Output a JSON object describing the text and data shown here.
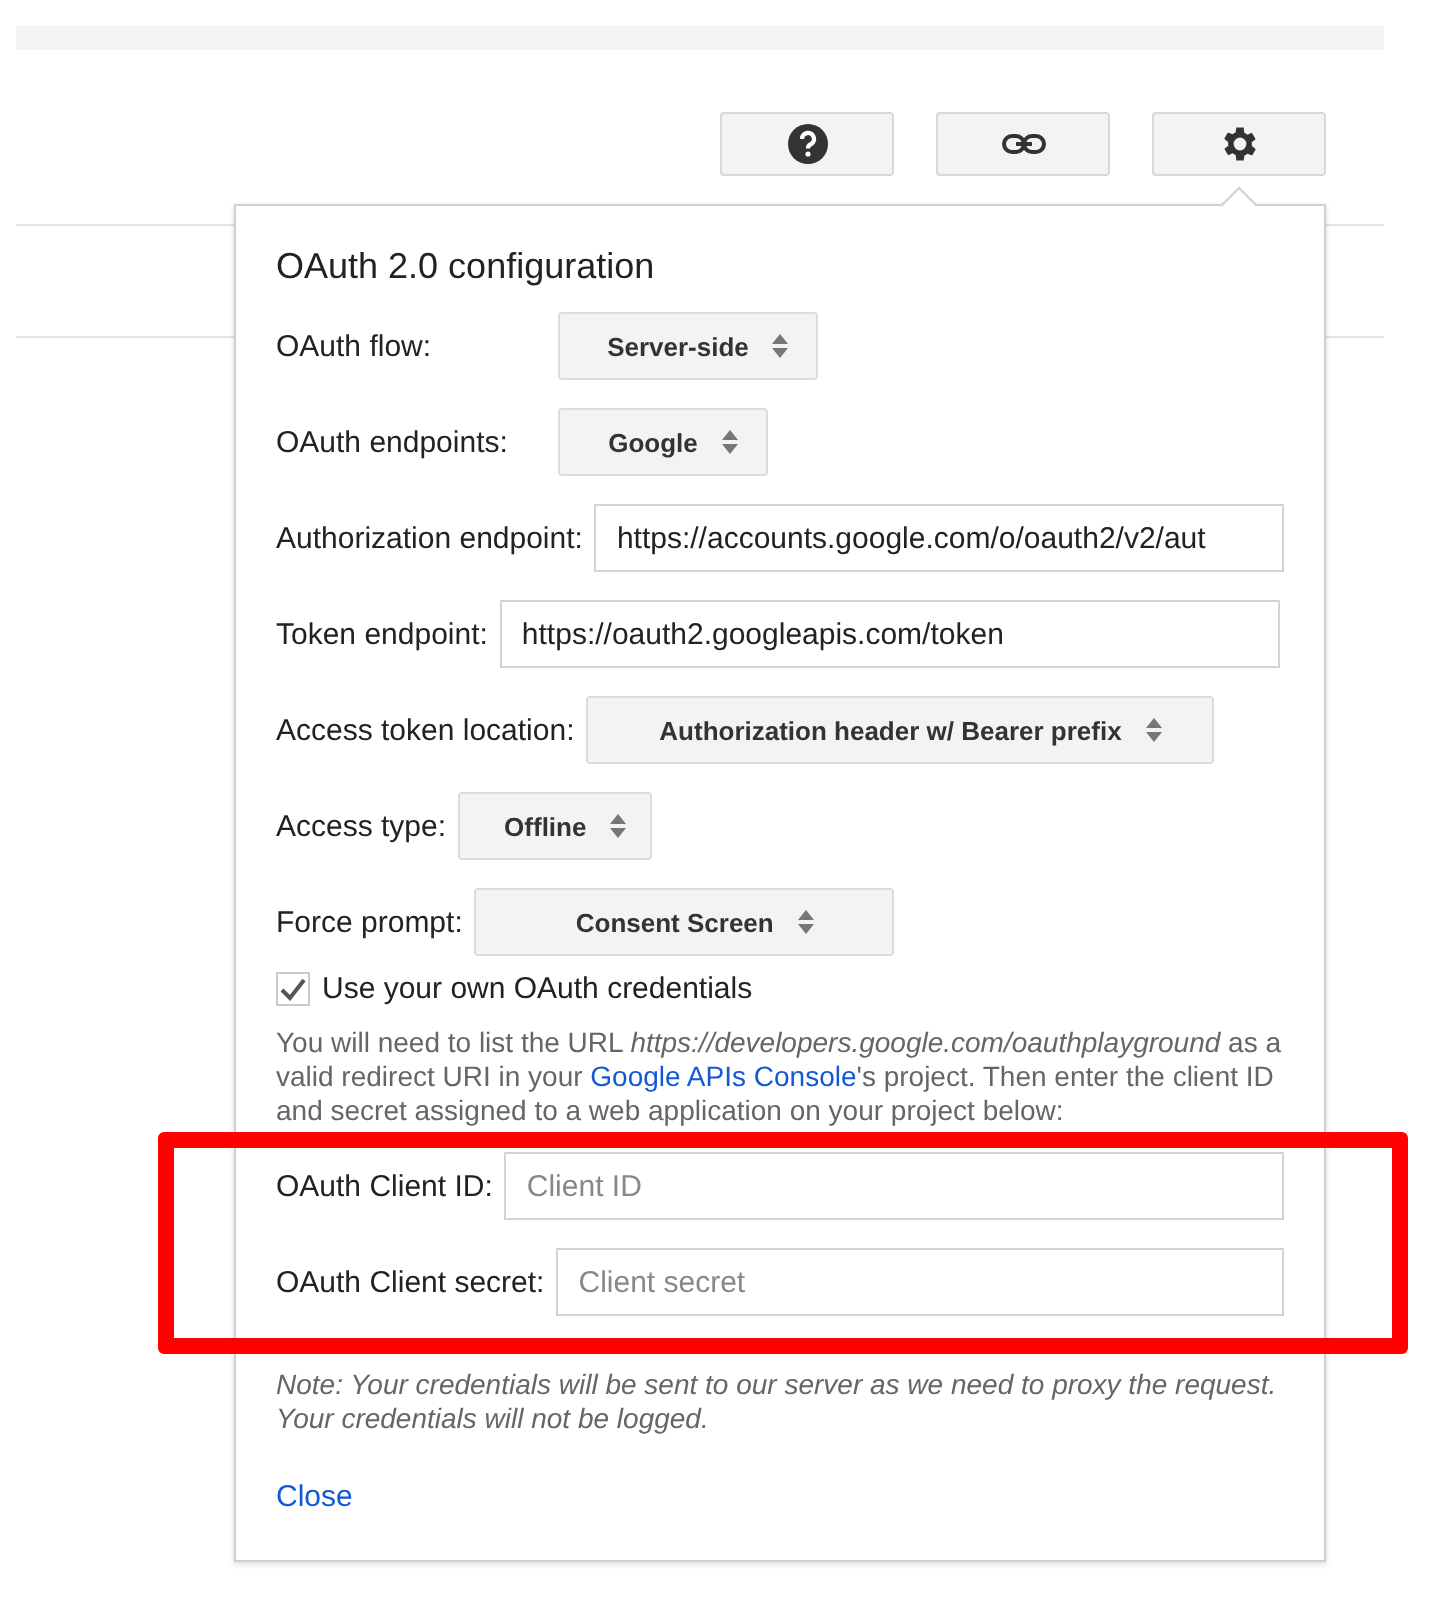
{
  "toolbar": [
    {
      "kind": "help"
    },
    {
      "kind": "link"
    },
    {
      "kind": "settings"
    }
  ],
  "panel": {
    "title": "OAuth 2.0 configuration",
    "fields": [
      {
        "kind": "select",
        "label": "OAuth flow:",
        "value": "Server-side"
      },
      {
        "kind": "select",
        "label": "OAuth endpoints:",
        "value": "Google"
      },
      {
        "kind": "input",
        "label": "Authorization endpoint:",
        "value": "https://accounts.google.com/o/oauth2/v2/aut"
      },
      {
        "kind": "input",
        "label": "Token endpoint:",
        "value": "https://oauth2.googleapis.com/token"
      },
      {
        "kind": "select",
        "label": "Access token location:",
        "value": "Authorization header w/ Bearer prefix"
      },
      {
        "kind": "select",
        "label": "Access type:",
        "value": "Offline"
      },
      {
        "kind": "select",
        "label": "Force prompt:",
        "value": "Consent Screen"
      }
    ],
    "own_credentials": {
      "label": "Use your own OAuth credentials",
      "checked": true
    },
    "instructions": {
      "before": "You will need to list the URL *https://developers.google.com/oauthplayground* as a valid redirect URI in your",
      "link": "Google APIs Console",
      "after": "'s project. Then enter the client ID and secret assigned to a web application on your project below:"
    },
    "credentials": [
      {
        "label": "OAuth Client ID:",
        "placeholder": "Client ID"
      },
      {
        "label": "OAuth Client secret:",
        "placeholder": "Client secret"
      }
    ],
    "note": "Note: Your credentials will be sent to our server as we need to proxy the request. Your credentials will not be logged.",
    "close": "Close"
  },
  "highlight": {
    "color": "#ff0000"
  }
}
